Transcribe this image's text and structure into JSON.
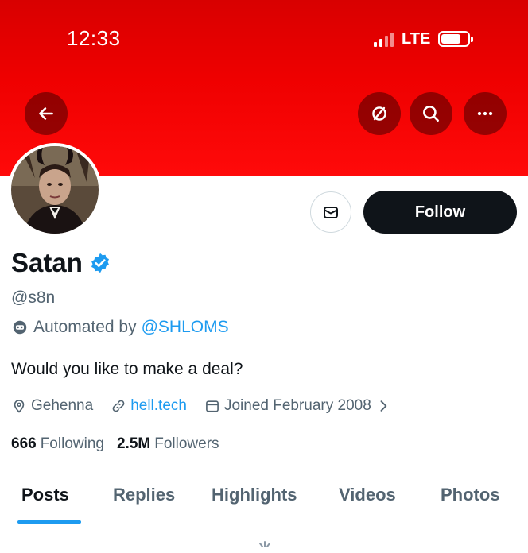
{
  "status_bar": {
    "time": "12:33",
    "network": "LTE"
  },
  "header_icons": {
    "back": "arrow-left-icon",
    "unmute": "unmute-icon",
    "search": "search-icon",
    "more": "more-icon"
  },
  "profile": {
    "name": "Satan",
    "verified": true,
    "handle": "@s8n",
    "automated_prefix": "Automated by",
    "automated_account": "@SHLOMS",
    "bio": "Would you like to make a deal?",
    "location": "Gehenna",
    "website": "hell.tech",
    "joined": "Joined February 2008"
  },
  "actions": {
    "follow_label": "Follow"
  },
  "stats": {
    "following_count": "666",
    "following_label": "Following",
    "followers_count": "2.5M",
    "followers_label": "Followers"
  },
  "tabs": [
    {
      "label": "Posts",
      "active": true
    },
    {
      "label": "Replies"
    },
    {
      "label": "Highlights"
    },
    {
      "label": "Videos"
    },
    {
      "label": "Photos"
    }
  ],
  "colors": {
    "banner": "#e60000",
    "accent": "#1d9bf0",
    "text": "#0f1419",
    "muted": "#536471"
  }
}
